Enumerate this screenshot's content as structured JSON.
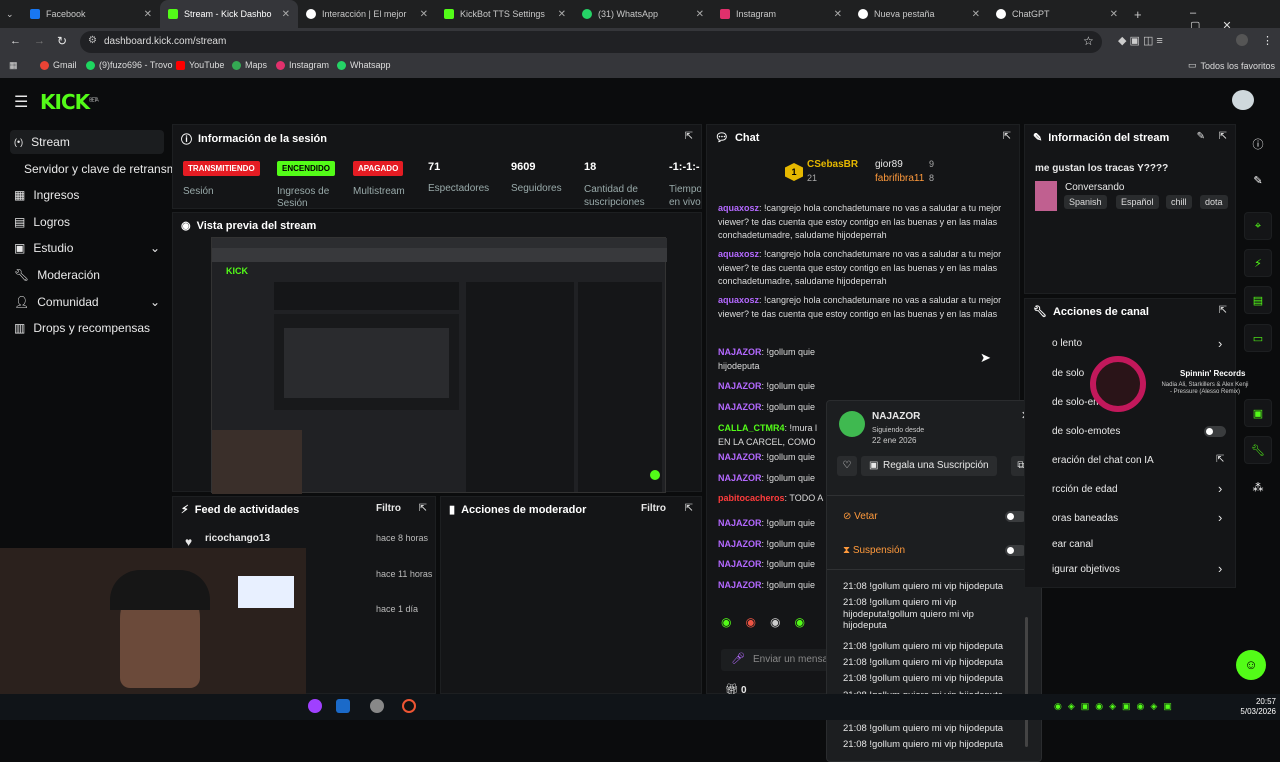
{
  "browser": {
    "tabs": [
      {
        "label": "Facebook",
        "color": "#1877f2"
      },
      {
        "label": "Stream - Kick Dashbo",
        "color": "#53fc18"
      },
      {
        "label": "Interacción | El mejor",
        "color": "#ffffff"
      },
      {
        "label": "KickBot TTS Settings",
        "color": "#53fc18"
      },
      {
        "label": "(31) WhatsApp",
        "color": "#25d366"
      },
      {
        "label": "Instagram",
        "color": "#e1306c"
      },
      {
        "label": "Nueva pestaña",
        "color": "#ffffff"
      },
      {
        "label": "ChatGPT",
        "color": "#ffffff"
      }
    ],
    "url": "dashboard.kick.com/stream",
    "bookmarks": [
      {
        "label": "Gmail",
        "color": "#ea4335"
      },
      {
        "label": "(9)fuzo696 - Trovo",
        "color": "#1ed760"
      },
      {
        "label": "YouTube",
        "color": "#ff0000"
      },
      {
        "label": "Maps",
        "color": "#34a853"
      },
      {
        "label": "Instagram",
        "color": "#e1306c"
      },
      {
        "label": "Whatsapp",
        "color": "#25d366"
      }
    ],
    "all_bookmarks": "Todos los favoritos"
  },
  "brand": {
    "logo": "KICK",
    "beta": "BETA",
    "accent": "#53fc18"
  },
  "nav": [
    {
      "label": "Stream",
      "icon": "dot-icon"
    },
    {
      "label": "Servidor y clave de retransmisión",
      "icon": ""
    },
    {
      "label": "Ingresos",
      "icon": "bars-icon"
    },
    {
      "label": "Logros",
      "icon": "book-icon"
    },
    {
      "label": "Estudio",
      "icon": "grid-icon"
    },
    {
      "label": "Moderación",
      "icon": "wrench-icon"
    },
    {
      "label": "Comunidad",
      "icon": "person-icon"
    },
    {
      "label": "Drops y recompensas",
      "icon": "calendar-icon"
    }
  ],
  "session": {
    "title": "Información de la sesión",
    "badges": [
      {
        "label": "TRANSMITIENDO",
        "sub": "Sesión"
      },
      {
        "label": "ENCENDIDO",
        "sub": "Ingresos de Sesión"
      },
      {
        "label": "APAGADO",
        "sub": "Multistream"
      }
    ],
    "stats": [
      {
        "value": "71",
        "label": "Espectadores"
      },
      {
        "value": "9609",
        "label": "Seguidores"
      },
      {
        "value": "18",
        "label": "Cantidad de suscripciones"
      },
      {
        "value": "-1:-1:-",
        "label": "Tiempo en vivo"
      }
    ]
  },
  "preview": {
    "title": "Vista previa del stream"
  },
  "feed": {
    "title": "Feed de actividades",
    "filter": "Filtro",
    "items": [
      {
        "user": "ricochango13",
        "time": "hace 8 horas"
      },
      {
        "user": "",
        "time": "hace 11 horas"
      },
      {
        "user": "",
        "time": "hace 1 día"
      }
    ]
  },
  "modactions": {
    "title": "Acciones de moderador",
    "filter": "Filtro"
  },
  "chat": {
    "title": "Chat",
    "top": [
      {
        "name": "CSebasBR",
        "count": "21",
        "rank": "1"
      },
      {
        "name": "gior89",
        "count": "9"
      },
      {
        "name": "fabrifibra11",
        "count": "8"
      }
    ],
    "messages": [
      {
        "user": "aquaxosz",
        "text": "!cangrejo hola conchadetumare no vas a saludar a tu mejor viewer? te das cuenta que estoy contigo en las buenas y en las malas conchadetumadre, saludame hijodeperrah",
        "color": "#b469ff"
      },
      {
        "user": "aquaxosz",
        "text": "!cangrejo hola conchadetumare no vas a saludar a tu mejor viewer? te das cuenta que estoy contigo en las buenas y en las malas conchadetumadre, saludame hijodeperrah",
        "color": "#b469ff"
      },
      {
        "user": "aquaxosz",
        "text": "!cangrejo hola conchadetumare no vas a saludar a tu mejor viewer? te das cuenta que estoy contigo en las buenas y en las malas conchadetumadr",
        "color": "#b469ff"
      },
      {
        "user": "NAJAZOR",
        "text": "!gollum quie hijodeputa",
        "color": "#b469ff"
      },
      {
        "user": "NAJAZOR",
        "text": "!gollum quie",
        "color": "#b469ff"
      },
      {
        "user": "NAJAZOR",
        "text": "!gollum quie",
        "color": "#b469ff"
      },
      {
        "user": "CALLA_CTMR4",
        "text": "!mura l EN LA CARCEL, COMO",
        "color": "#53fc18"
      },
      {
        "user": "NAJAZOR",
        "text": "!gollum quie",
        "color": "#b469ff"
      },
      {
        "user": "NAJAZOR",
        "text": "!gollum quie",
        "color": "#b469ff"
      },
      {
        "user": "pabitocacheros",
        "text": "TODO A",
        "color": "#ff3c3c"
      },
      {
        "user": "NAJAZOR",
        "text": "!gollum quie",
        "color": "#b469ff"
      },
      {
        "user": "NAJAZOR",
        "text": "!gollum quie",
        "color": "#b469ff"
      },
      {
        "user": "NAJAZOR",
        "text": "!gollum quie",
        "color": "#b469ff"
      },
      {
        "user": "NAJAZOR",
        "text": "!gollum quie",
        "color": "#b469ff"
      }
    ],
    "placeholder": "Enviar un mensaje",
    "points": "0"
  },
  "usercard": {
    "name": "NAJAZOR",
    "since_label": "Siguiendo desde",
    "since_date": "22 ene 2026",
    "gift": "Regala una Suscripción",
    "ban": "Vetar",
    "timeout": "Suspensión",
    "log": [
      "21:08 !gollum quiero mi vip hijodeputa",
      "21:08 !gollum quiero mi vip hijodeputa!gollum quiero mi vip hijodeputa",
      "21:08 !gollum quiero mi vip hijodeputa",
      "21:08 !gollum quiero mi vip hijodeputa",
      "21:08 !gollum quiero mi vip hijodeputa",
      "21:08 !gollum quiero mi vip hijodeputa",
      "21:08 !gollum quiero mi vip hijodeputa",
      "21:08 !gollum quiero mi vip hijodeputa",
      "21:08 !gollum quiero mi vip hijodeputa"
    ]
  },
  "streaminfo": {
    "title": "Información del stream",
    "stream_title": "me gustan los tracas Y????",
    "category": "Conversando",
    "tags": [
      "Spanish",
      "Español",
      "chill",
      "dota"
    ]
  },
  "channel": {
    "title": "Acciones de canal",
    "items": [
      "o lento",
      "de solo",
      "de solo-emotes",
      "de solo-emotes",
      "eración del chat con IA",
      "rcción de edad",
      "oras baneadas",
      "ear canal",
      "igurar objetivos"
    ]
  },
  "music": {
    "label": "Spinnin' Records",
    "artists": "Nadia Ali, Starkillers & Alex Kenji - Pressure (Alesso Remix)"
  },
  "clock": {
    "time": "20:57",
    "date": "5/03/2026"
  }
}
